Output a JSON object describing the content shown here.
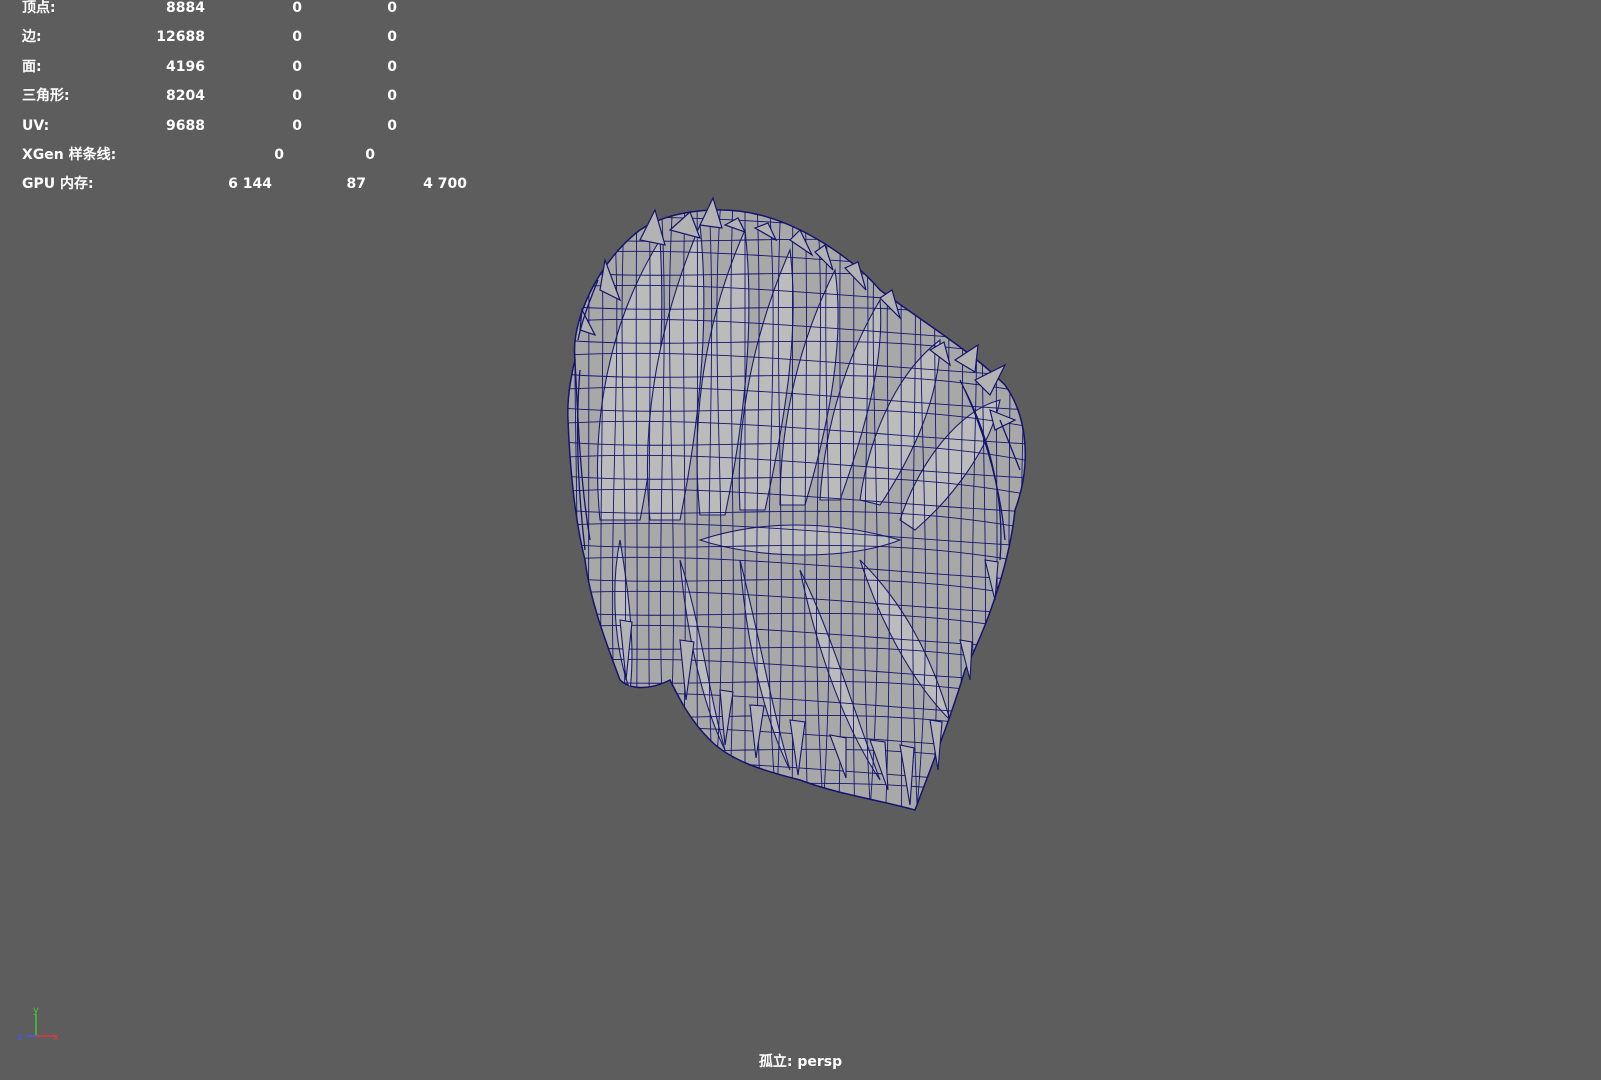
{
  "hud": {
    "rows": [
      {
        "label": "顶点:",
        "v1": "8884",
        "v2": "0",
        "v3": "0"
      },
      {
        "label": "边:",
        "v1": "12688",
        "v2": "0",
        "v3": "0"
      },
      {
        "label": "面:",
        "v1": "4196",
        "v2": "0",
        "v3": "0"
      },
      {
        "label": "三角形:",
        "v1": "8204",
        "v2": "0",
        "v3": "0"
      },
      {
        "label": "UV:",
        "v1": "9688",
        "v2": "0",
        "v3": "0"
      },
      {
        "label": "XGen 样条线:",
        "v1": "0",
        "v2": "0"
      },
      {
        "label": "GPU 内存:",
        "v1": "6 144",
        "v2": "87",
        "v3": "4 700"
      }
    ]
  },
  "viewport": {
    "camera_label": "孤立: persp",
    "background_color": "#5d5d5d",
    "mesh_fill_color": "#a6a6a6",
    "wireframe_color": "#14146e"
  },
  "axis_gizmo": {
    "y": "y",
    "z": "z",
    "x": "x",
    "y_color": "#3ec43e",
    "z_color": "#3c5cff",
    "x_color": "#e03a3a"
  }
}
